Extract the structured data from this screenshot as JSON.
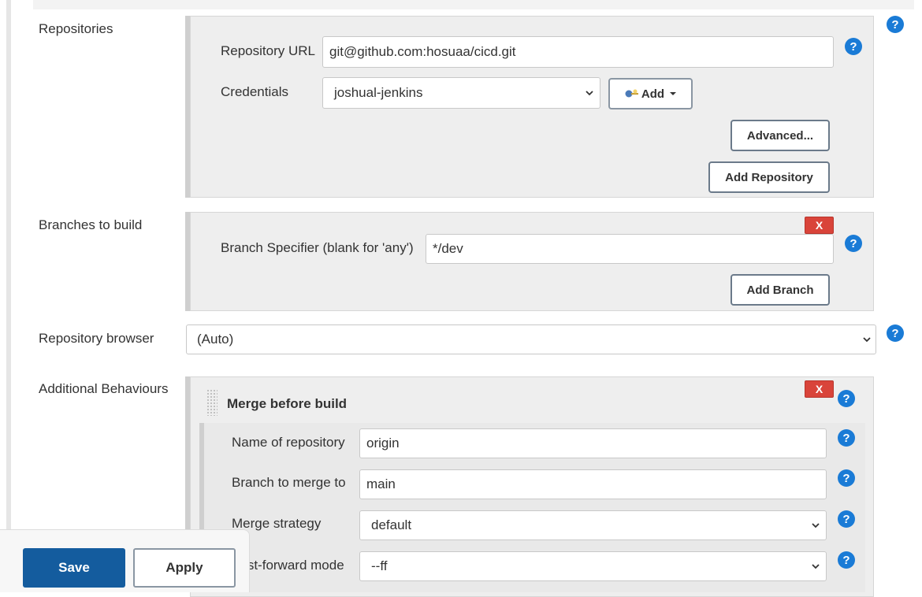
{
  "repositories": {
    "label": "Repositories",
    "url_label": "Repository URL",
    "url_value": "git@github.com:hosuaa/cicd.git",
    "credentials_label": "Credentials",
    "credentials_value": "joshual-jenkins",
    "add_label": "Add",
    "advanced_label": "Advanced...",
    "add_repository_label": "Add Repository"
  },
  "branches": {
    "label": "Branches to build",
    "remove_label": "X",
    "specifier_label": "Branch Specifier (blank for 'any')",
    "specifier_value": "*/dev",
    "add_branch_label": "Add Branch"
  },
  "browser": {
    "label": "Repository browser",
    "value": "(Auto)"
  },
  "behaviours": {
    "label": "Additional Behaviours",
    "remove_label": "X",
    "merge": {
      "title": "Merge before build",
      "repo_name_label": "Name of repository",
      "repo_name_value": "origin",
      "branch_label": "Branch to merge to",
      "branch_value": "main",
      "strategy_label": "Merge strategy",
      "strategy_value": "default",
      "ff_label": "Fast-forward mode",
      "ff_value": "--ff"
    }
  },
  "help_glyph": "?",
  "footer": {
    "save_label": "Save",
    "apply_label": "Apply"
  },
  "colors": {
    "help": "#1a7bd6",
    "remove": "#d9443a",
    "save": "#145c9e"
  }
}
